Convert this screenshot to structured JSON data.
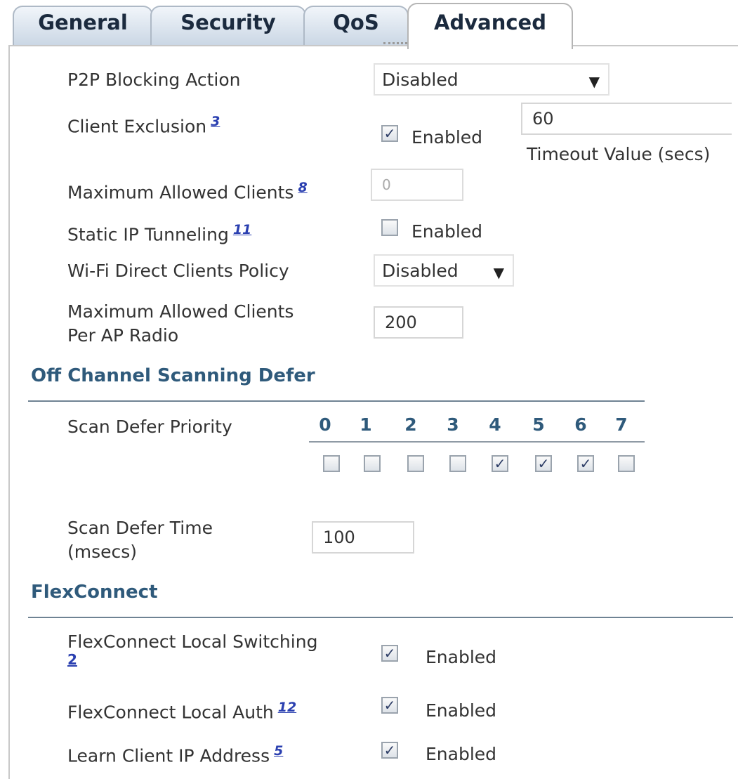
{
  "tabs": [
    {
      "label": "General",
      "active": false
    },
    {
      "label": "Security",
      "active": false
    },
    {
      "label": "QoS",
      "active": false
    },
    {
      "label": "Advanced",
      "active": true
    }
  ],
  "p2p": {
    "label": "P2P Blocking Action",
    "value": "Disabled"
  },
  "client_exclusion": {
    "label": "Client Exclusion",
    "footnote": "3",
    "checked": true,
    "checkbox_label": "Enabled",
    "timeout_value": "60",
    "timeout_label": "Timeout Value (secs)"
  },
  "max_clients": {
    "label": "Maximum Allowed Clients",
    "footnote": "8",
    "value": "0"
  },
  "static_ip": {
    "label": "Static IP Tunneling",
    "footnote": "11",
    "checked": false,
    "checkbox_label": "Enabled"
  },
  "wifi_direct": {
    "label": "Wi-Fi Direct Clients Policy",
    "value": "Disabled"
  },
  "max_clients_radio": {
    "label_line1": "Maximum Allowed Clients",
    "label_line2": "Per AP Radio",
    "value": "200"
  },
  "off_channel": {
    "title": "Off Channel Scanning Defer",
    "scan_priority_label": "Scan Defer Priority",
    "priorities": [
      "0",
      "1",
      "2",
      "3",
      "4",
      "5",
      "6",
      "7"
    ],
    "checked": [
      false,
      false,
      false,
      false,
      true,
      true,
      true,
      false
    ],
    "scan_time_label_line1": "Scan Defer Time",
    "scan_time_label_line2": "(msecs)",
    "scan_time_value": "100"
  },
  "flexconnect": {
    "title": "FlexConnect",
    "local_switching": {
      "label": "FlexConnect Local Switching",
      "footnote": "2",
      "checked": true,
      "checkbox_label": "Enabled"
    },
    "local_auth": {
      "label": "FlexConnect Local Auth",
      "footnote": "12",
      "checked": true,
      "checkbox_label": "Enabled"
    },
    "learn_ip": {
      "label": "Learn Client IP Address",
      "footnote": "5",
      "checked": true,
      "checkbox_label": "Enabled"
    }
  },
  "check_glyph": "✓"
}
